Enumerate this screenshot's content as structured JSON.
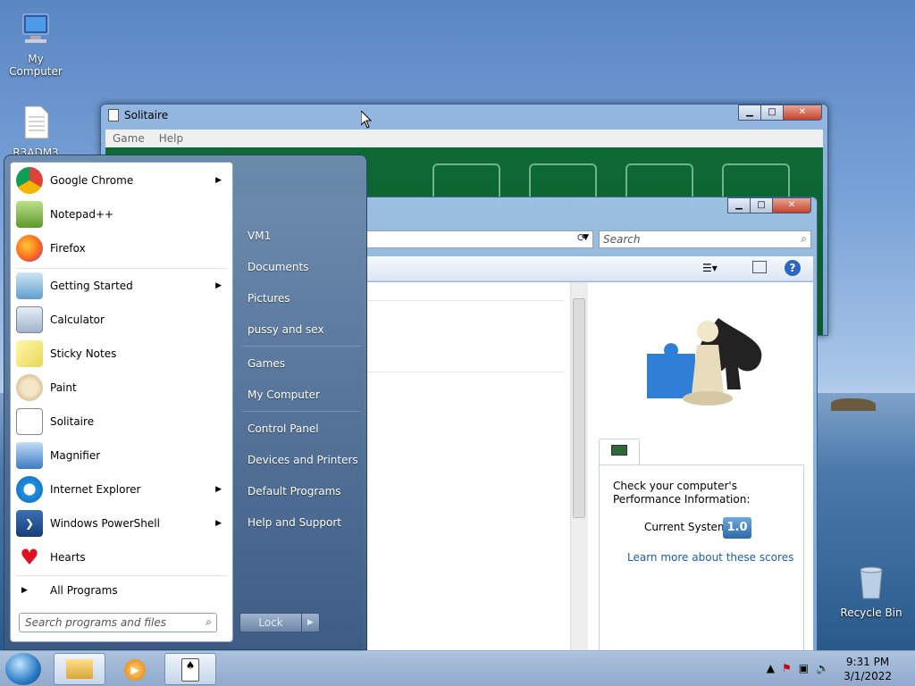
{
  "desktop": {
    "icons": [
      {
        "label": "My Computer"
      },
      {
        "label": "R3ADM3"
      },
      {
        "label": "Recycle Bin"
      }
    ]
  },
  "solitaire": {
    "title": "Solitaire",
    "menu": [
      "Game",
      "Help"
    ]
  },
  "explorer": {
    "search_placeholder": "Search",
    "perf_text": "Check your computer's Performance Information:",
    "current_system_label": "Current System",
    "score": "1.0",
    "learn_more": "Learn more about these scores"
  },
  "start_menu": {
    "pinned": [
      {
        "label": "Google Chrome",
        "has_submenu": true
      },
      {
        "label": "Notepad++",
        "has_submenu": false
      },
      {
        "label": "Firefox",
        "has_submenu": false
      }
    ],
    "recent": [
      {
        "label": "Getting Started",
        "has_submenu": true
      },
      {
        "label": "Calculator",
        "has_submenu": false
      },
      {
        "label": "Sticky Notes",
        "has_submenu": false
      },
      {
        "label": "Paint",
        "has_submenu": false
      },
      {
        "label": "Solitaire",
        "has_submenu": false
      },
      {
        "label": "Magnifier",
        "has_submenu": false
      },
      {
        "label": "Internet Explorer",
        "has_submenu": true
      },
      {
        "label": "Windows PowerShell",
        "has_submenu": true
      },
      {
        "label": "Hearts",
        "has_submenu": false
      }
    ],
    "all_programs": "All Programs",
    "search_placeholder": "Search programs and files",
    "right": [
      "VM1",
      "Documents",
      "Pictures",
      "pussy and sex",
      "Games",
      "My Computer",
      "Control Panel",
      "Devices and Printers",
      "Default Programs",
      "Help and Support"
    ],
    "lock_label": "Lock"
  },
  "taskbar": {
    "time": "9:31 PM",
    "date": "3/1/2022"
  }
}
